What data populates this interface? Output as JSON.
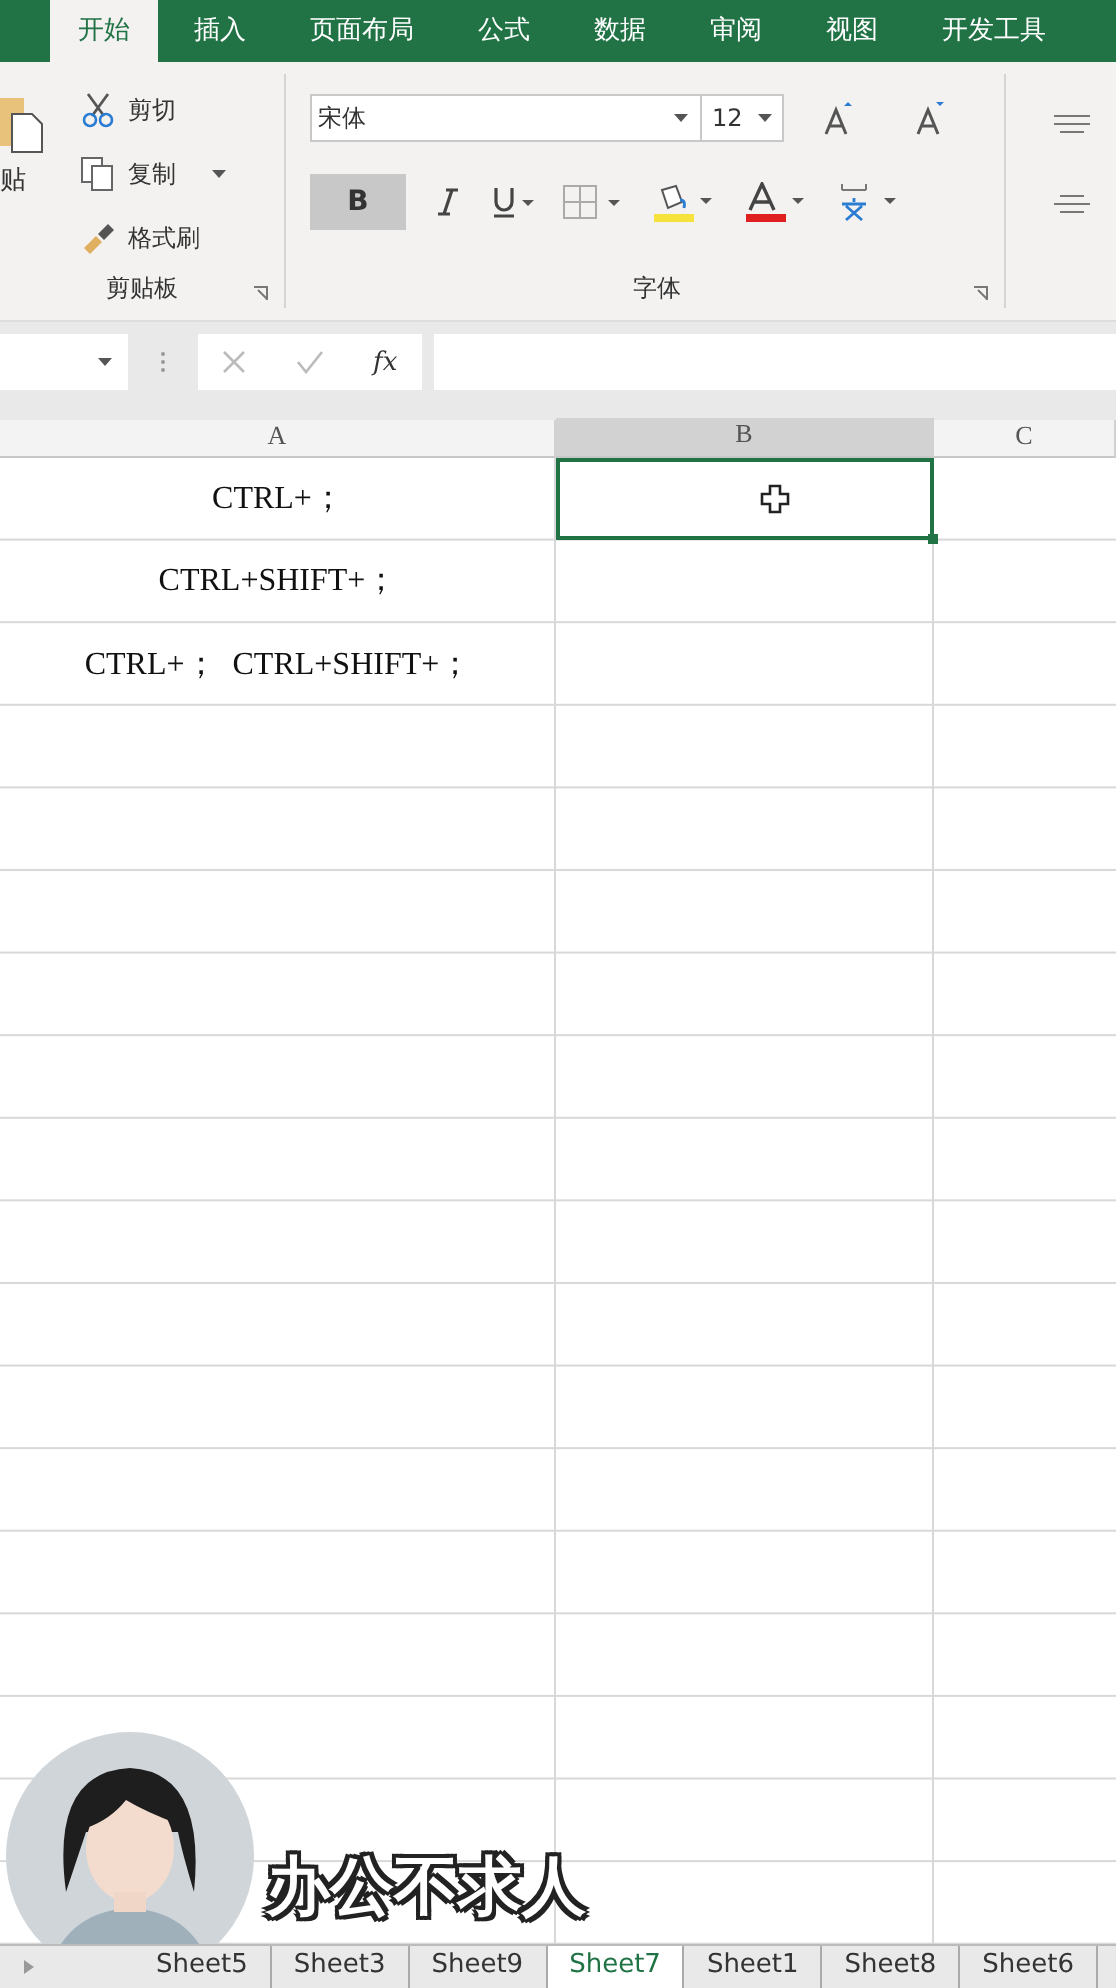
{
  "ribbon_tabs": [
    {
      "label": "开始",
      "selected": true
    },
    {
      "label": "插入",
      "selected": false
    },
    {
      "label": "页面布局",
      "selected": false
    },
    {
      "label": "公式",
      "selected": false
    },
    {
      "label": "数据",
      "selected": false
    },
    {
      "label": "审阅",
      "selected": false
    },
    {
      "label": "视图",
      "selected": false
    },
    {
      "label": "开发工具",
      "selected": false
    }
  ],
  "clipboard": {
    "paste_label": "贴",
    "group_label": "剪贴板",
    "items": [
      {
        "kind": "cut",
        "label": "剪切"
      },
      {
        "kind": "copy",
        "label": "复制"
      },
      {
        "kind": "painter",
        "label": "格式刷"
      }
    ]
  },
  "font": {
    "name": "宋体",
    "size": "12",
    "group_label": "字体",
    "bold_label": "B",
    "bold": true
  },
  "formula_bar": {
    "function_label": "fx"
  },
  "columns": [
    {
      "label": "A",
      "selected": false
    },
    {
      "label": "B",
      "selected": true
    },
    {
      "label": "C",
      "selected": false
    }
  ],
  "rows": [
    {
      "cells": [
        {
          "text": "CTRL+；",
          "selected": false
        },
        {
          "selected": true
        },
        {
          "selected": false
        }
      ]
    },
    {
      "cells": [
        {
          "text": "CTRL+SHIFT+；",
          "selected": false
        },
        {
          "selected": false
        },
        {
          "selected": false
        }
      ]
    },
    {
      "cells": [
        {
          "text": "CTRL+；  CTRL+SHIFT+；",
          "selected": false
        },
        {
          "selected": false
        },
        {
          "selected": false
        }
      ]
    }
  ],
  "sheet_tabs": [
    {
      "label": "Sheet5",
      "selected": false
    },
    {
      "label": "Sheet3",
      "selected": false
    },
    {
      "label": "Sheet9",
      "selected": false
    },
    {
      "label": "Sheet7",
      "selected": true
    },
    {
      "label": "Sheet1",
      "selected": false
    },
    {
      "label": "Sheet8",
      "selected": false
    },
    {
      "label": "Sheet6",
      "selected": false
    }
  ],
  "overlay": {
    "caption": "办公不求人"
  }
}
